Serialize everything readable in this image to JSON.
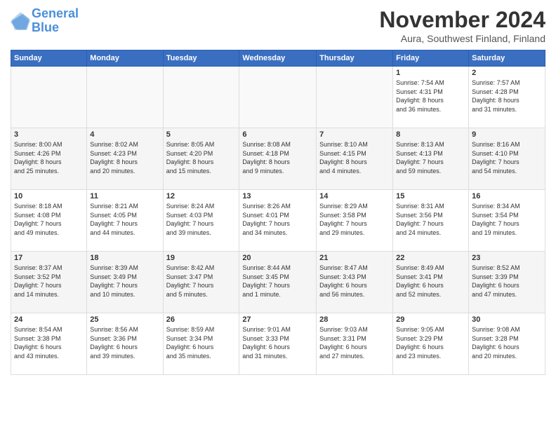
{
  "logo": {
    "line1": "General",
    "line2": "Blue"
  },
  "title": "November 2024",
  "location": "Aura, Southwest Finland, Finland",
  "days_header": [
    "Sunday",
    "Monday",
    "Tuesday",
    "Wednesday",
    "Thursday",
    "Friday",
    "Saturday"
  ],
  "weeks": [
    [
      {
        "day": "",
        "info": ""
      },
      {
        "day": "",
        "info": ""
      },
      {
        "day": "",
        "info": ""
      },
      {
        "day": "",
        "info": ""
      },
      {
        "day": "",
        "info": ""
      },
      {
        "day": "1",
        "info": "Sunrise: 7:54 AM\nSunset: 4:31 PM\nDaylight: 8 hours\nand 36 minutes."
      },
      {
        "day": "2",
        "info": "Sunrise: 7:57 AM\nSunset: 4:28 PM\nDaylight: 8 hours\nand 31 minutes."
      }
    ],
    [
      {
        "day": "3",
        "info": "Sunrise: 8:00 AM\nSunset: 4:26 PM\nDaylight: 8 hours\nand 25 minutes."
      },
      {
        "day": "4",
        "info": "Sunrise: 8:02 AM\nSunset: 4:23 PM\nDaylight: 8 hours\nand 20 minutes."
      },
      {
        "day": "5",
        "info": "Sunrise: 8:05 AM\nSunset: 4:20 PM\nDaylight: 8 hours\nand 15 minutes."
      },
      {
        "day": "6",
        "info": "Sunrise: 8:08 AM\nSunset: 4:18 PM\nDaylight: 8 hours\nand 9 minutes."
      },
      {
        "day": "7",
        "info": "Sunrise: 8:10 AM\nSunset: 4:15 PM\nDaylight: 8 hours\nand 4 minutes."
      },
      {
        "day": "8",
        "info": "Sunrise: 8:13 AM\nSunset: 4:13 PM\nDaylight: 7 hours\nand 59 minutes."
      },
      {
        "day": "9",
        "info": "Sunrise: 8:16 AM\nSunset: 4:10 PM\nDaylight: 7 hours\nand 54 minutes."
      }
    ],
    [
      {
        "day": "10",
        "info": "Sunrise: 8:18 AM\nSunset: 4:08 PM\nDaylight: 7 hours\nand 49 minutes."
      },
      {
        "day": "11",
        "info": "Sunrise: 8:21 AM\nSunset: 4:05 PM\nDaylight: 7 hours\nand 44 minutes."
      },
      {
        "day": "12",
        "info": "Sunrise: 8:24 AM\nSunset: 4:03 PM\nDaylight: 7 hours\nand 39 minutes."
      },
      {
        "day": "13",
        "info": "Sunrise: 8:26 AM\nSunset: 4:01 PM\nDaylight: 7 hours\nand 34 minutes."
      },
      {
        "day": "14",
        "info": "Sunrise: 8:29 AM\nSunset: 3:58 PM\nDaylight: 7 hours\nand 29 minutes."
      },
      {
        "day": "15",
        "info": "Sunrise: 8:31 AM\nSunset: 3:56 PM\nDaylight: 7 hours\nand 24 minutes."
      },
      {
        "day": "16",
        "info": "Sunrise: 8:34 AM\nSunset: 3:54 PM\nDaylight: 7 hours\nand 19 minutes."
      }
    ],
    [
      {
        "day": "17",
        "info": "Sunrise: 8:37 AM\nSunset: 3:52 PM\nDaylight: 7 hours\nand 14 minutes."
      },
      {
        "day": "18",
        "info": "Sunrise: 8:39 AM\nSunset: 3:49 PM\nDaylight: 7 hours\nand 10 minutes."
      },
      {
        "day": "19",
        "info": "Sunrise: 8:42 AM\nSunset: 3:47 PM\nDaylight: 7 hours\nand 5 minutes."
      },
      {
        "day": "20",
        "info": "Sunrise: 8:44 AM\nSunset: 3:45 PM\nDaylight: 7 hours\nand 1 minute."
      },
      {
        "day": "21",
        "info": "Sunrise: 8:47 AM\nSunset: 3:43 PM\nDaylight: 6 hours\nand 56 minutes."
      },
      {
        "day": "22",
        "info": "Sunrise: 8:49 AM\nSunset: 3:41 PM\nDaylight: 6 hours\nand 52 minutes."
      },
      {
        "day": "23",
        "info": "Sunrise: 8:52 AM\nSunset: 3:39 PM\nDaylight: 6 hours\nand 47 minutes."
      }
    ],
    [
      {
        "day": "24",
        "info": "Sunrise: 8:54 AM\nSunset: 3:38 PM\nDaylight: 6 hours\nand 43 minutes."
      },
      {
        "day": "25",
        "info": "Sunrise: 8:56 AM\nSunset: 3:36 PM\nDaylight: 6 hours\nand 39 minutes."
      },
      {
        "day": "26",
        "info": "Sunrise: 8:59 AM\nSunset: 3:34 PM\nDaylight: 6 hours\nand 35 minutes."
      },
      {
        "day": "27",
        "info": "Sunrise: 9:01 AM\nSunset: 3:33 PM\nDaylight: 6 hours\nand 31 minutes."
      },
      {
        "day": "28",
        "info": "Sunrise: 9:03 AM\nSunset: 3:31 PM\nDaylight: 6 hours\nand 27 minutes."
      },
      {
        "day": "29",
        "info": "Sunrise: 9:05 AM\nSunset: 3:29 PM\nDaylight: 6 hours\nand 23 minutes."
      },
      {
        "day": "30",
        "info": "Sunrise: 9:08 AM\nSunset: 3:28 PM\nDaylight: 6 hours\nand 20 minutes."
      }
    ]
  ]
}
